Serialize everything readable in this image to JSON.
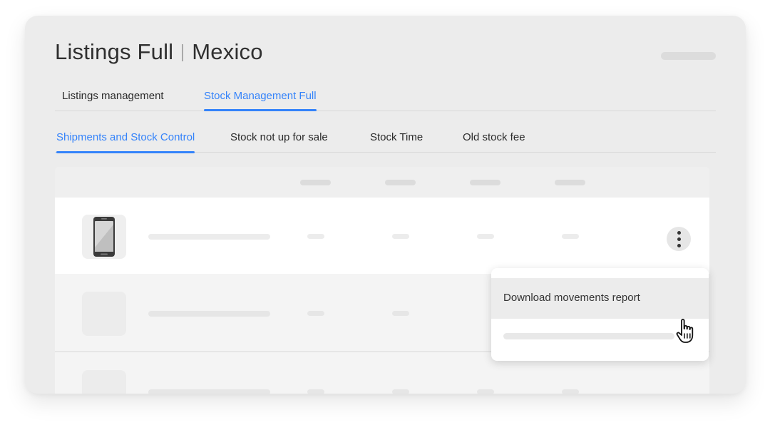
{
  "page": {
    "title_left": "Listings Full",
    "title_right": "Mexico"
  },
  "tabs_top": [
    {
      "label": "Listings management",
      "active": false
    },
    {
      "label": "Stock Management Full",
      "active": true
    }
  ],
  "tabs_sub": [
    {
      "label": "Shipments and Stock Control",
      "active": true
    },
    {
      "label": "Stock not up for sale",
      "active": false
    },
    {
      "label": "Stock Time",
      "active": false
    },
    {
      "label": "Old stock fee",
      "active": false
    }
  ],
  "menu": {
    "items": [
      {
        "label": "Download movements report"
      }
    ]
  },
  "colors": {
    "accent": "#3483fa",
    "card_bg": "#ececec",
    "text": "#2f2f2f"
  },
  "icons": {
    "product": "smartphone-icon",
    "actions": "more-vertical-icon",
    "cursor": "hand-pointer-icon"
  }
}
